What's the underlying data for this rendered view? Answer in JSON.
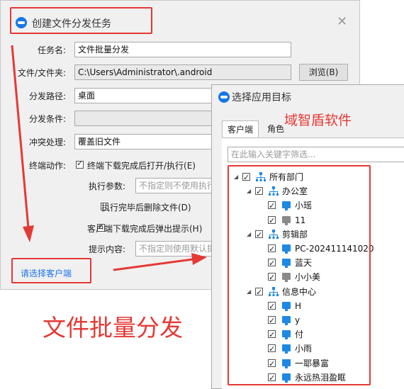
{
  "colors": {
    "accent": "#1677e5",
    "annotation_red": "#e53935",
    "link_blue": "#1a73e8"
  },
  "main_dialog": {
    "title": "创建文件分发任务",
    "close_icon": "close-icon",
    "fields": {
      "task_name_label": "任务名:",
      "task_name_value": "文件批量分发",
      "file_label": "文件/文件夹:",
      "file_value": "C:\\Users\\Administrator\\.android",
      "browse_button": "浏览(B)",
      "path_label": "分发路径:",
      "path_value": "桌面",
      "condition_label": "分发条件:",
      "condition_value": "",
      "conflict_label": "冲突处理:",
      "conflict_value": "覆盖旧文件",
      "action_label": "终端动作:",
      "open_after_download": "终端下载完成后打开/执行(E)",
      "exec_params_label": "执行参数:",
      "exec_params_placeholder": "不指定则不使用执行",
      "delete_after_exec": "执行完毕后删除文件(D)",
      "popup_after_download": "客户端下载完成后弹出提示(H)",
      "prompt_label": "提示内容:",
      "prompt_placeholder": "不指定则使用默认提"
    },
    "select_client_link": "请选择客户端"
  },
  "annotation_caption": "文件批量分发",
  "picker_dialog": {
    "title": "选择应用目标",
    "brand_annotation": "域智盾软件",
    "tabs": [
      "客户端",
      "角色"
    ],
    "search_placeholder": "在此输入关键字筛选...",
    "tree": [
      {
        "label": "所有部门",
        "type": "org",
        "level": 0,
        "expanded": true
      },
      {
        "label": "办公室",
        "type": "org",
        "level": 1,
        "expanded": true
      },
      {
        "label": "小瑶",
        "type": "pc",
        "level": 2,
        "online": true
      },
      {
        "label": "11",
        "type": "pc",
        "level": 2,
        "online": false
      },
      {
        "label": "剪辑部",
        "type": "org",
        "level": 1,
        "expanded": true
      },
      {
        "label": "PC-202411141020",
        "type": "pc",
        "level": 2,
        "online": true
      },
      {
        "label": "蓝天",
        "type": "pc",
        "level": 2,
        "online": true
      },
      {
        "label": "小小美",
        "type": "pc",
        "level": 2,
        "online": false
      },
      {
        "label": "信息中心",
        "type": "org",
        "level": 1,
        "expanded": true
      },
      {
        "label": "H",
        "type": "pc",
        "level": 2,
        "online": true
      },
      {
        "label": "y",
        "type": "pc",
        "level": 2,
        "online": true
      },
      {
        "label": "付",
        "type": "pc",
        "level": 2,
        "online": true
      },
      {
        "label": "小雨",
        "type": "pc",
        "level": 2,
        "online": true
      },
      {
        "label": "一耶暴富",
        "type": "pc",
        "level": 2,
        "online": true
      },
      {
        "label": "永远热泪盈眶",
        "type": "pc",
        "level": 2,
        "online": true
      }
    ]
  }
}
